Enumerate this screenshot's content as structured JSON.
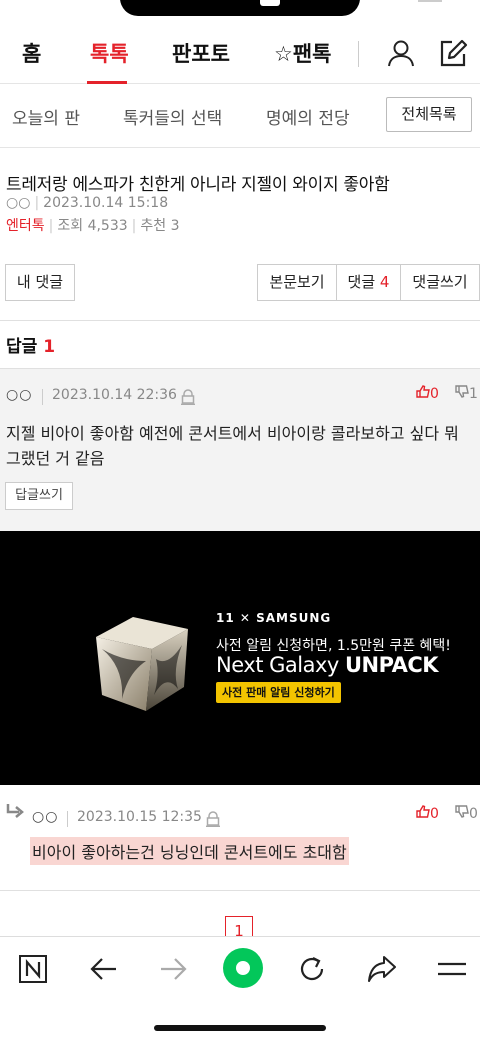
{
  "nav": {
    "items": [
      "홈",
      "톡톡",
      "판포토",
      "☆팬톡"
    ],
    "active": "톡톡"
  },
  "subtabs": {
    "items": [
      "오늘의 판",
      "톡커들의 선택",
      "명예의 전당"
    ],
    "all_button": "전체목록"
  },
  "post": {
    "title": "트레저랑 에스파가 친한게 아니라 지젤이 와이지 좋아함",
    "author": "○○",
    "date": "2023.10.14 15:18",
    "category": "엔터톡",
    "views_label": "조회",
    "views": "4,533",
    "recommend_label": "추천",
    "recommend": "3"
  },
  "buttons": {
    "my_comments": "내 댓글",
    "view_body": "본문보기",
    "comments_label": "댓글",
    "comments_count": "4",
    "write_comment": "댓글쓰기"
  },
  "replies": {
    "label": "답글",
    "count": "1"
  },
  "comment": {
    "author": "○○",
    "date": "2023.10.14 22:36",
    "upvotes": "0",
    "downvotes": "1",
    "text": "지젤 비아이 좋아함 예전에 콘서트에서 비아이랑 콜라보하고 싶다 뭐 그랬던 거 같음",
    "reply_button": "답글쓰기"
  },
  "ad": {
    "brand": "11 ✕ SAMSUNG",
    "line1": "사전 알림 신청하면, 1.5만원 쿠폰 혜택!",
    "line2_a": "Next Galaxy ",
    "line2_b": "UNPACK",
    "cta": "사전 판매 알림 신청하기"
  },
  "nested_reply": {
    "author": "○○",
    "date": "2023.10.15 12:35",
    "upvotes": "0",
    "downvotes": "0",
    "text": "비아이 좋아하는건 닝닝인데 콘서트에도 초대함"
  },
  "pagination": {
    "current": "1"
  },
  "colors": {
    "accent": "#e4222a",
    "browser_green": "#03c75a"
  },
  "bottom_icons": [
    "naver-n-icon",
    "back-arrow-icon",
    "forward-arrow-icon",
    "green-dot-icon",
    "refresh-icon",
    "share-icon",
    "menu-icon"
  ]
}
